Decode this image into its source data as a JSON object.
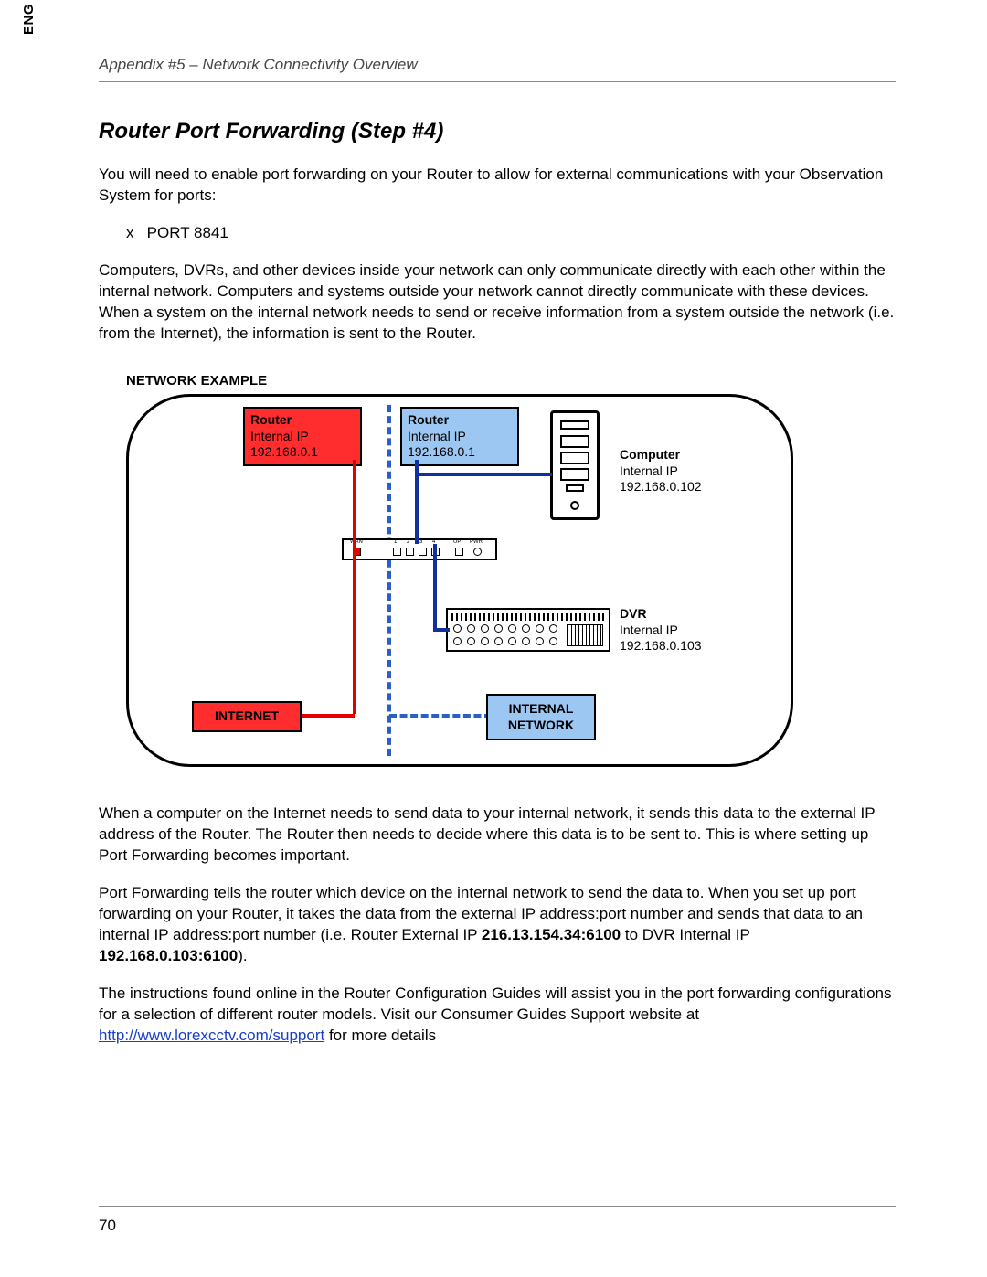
{
  "eng_tab": "ENG",
  "header": "Appendix #5 – Network Connectivity Overview",
  "title": "Router Port Forwarding (Step #4)",
  "p1": "You will need to enable port forwarding on your Router to allow for external communications with your Observation System for ports:",
  "bullet_marker": "x",
  "bullet_text": "PORT 8841",
  "p2": "Computers, DVRs, and other devices inside your network can only communicate directly with each other within the internal network. Computers and systems outside your network cannot directly communicate with these devices. When a system on the internal network needs to send or receive information from a system outside the network (i.e. from the Internet), the information is sent to the Router.",
  "net_heading": "NETWORK EXAMPLE",
  "diagram": {
    "router_red": {
      "title": "Router",
      "l1": "Internal IP",
      "l2": "192.168.0.1"
    },
    "router_blue": {
      "title": "Router",
      "l1": "Internal IP",
      "l2": "192.168.0.1"
    },
    "computer": {
      "title": "Computer",
      "l1": "Internal IP",
      "l2": "192.168.0.102"
    },
    "dvr": {
      "title": "DVR",
      "l1": "Internal IP",
      "l2": "192.168.0.103"
    },
    "internet_tag": "INTERNET",
    "internal_tag_l1": "INTERNAL",
    "internal_tag_l2": "NETWORK",
    "port_labels": {
      "wan": "WAN",
      "p1": "1",
      "p2": "2",
      "p3": "3",
      "p4": "4",
      "up": "UP",
      "pwr": "PWR"
    }
  },
  "p3": "When a computer on the Internet needs to send data to your internal network, it sends this data to the external IP address of the Router. The Router then needs to decide where this data is to be sent to. This is where setting up Port Forwarding becomes important.",
  "p4_a": "Port Forwarding tells the router which device on the internal network to send the data to. When you set up port forwarding on your Router, it takes the data from the external IP address:port number and sends that data to an internal IP address:port number (i.e. Router External IP ",
  "p4_bold1": "216.13.154.34:6100",
  "p4_b": " to DVR Internal IP ",
  "p4_bold2": "192.168.0.103:6100",
  "p4_c": ").",
  "p5_a": "The instructions found online in the Router Configuration Guides will assist you in the port forwarding configurations for a selection of different router models. Visit our Consumer Guides Support website at ",
  "p5_link": "http://www.lorexcctv.com/support",
  "p5_b": " for more details",
  "page_no": "70"
}
